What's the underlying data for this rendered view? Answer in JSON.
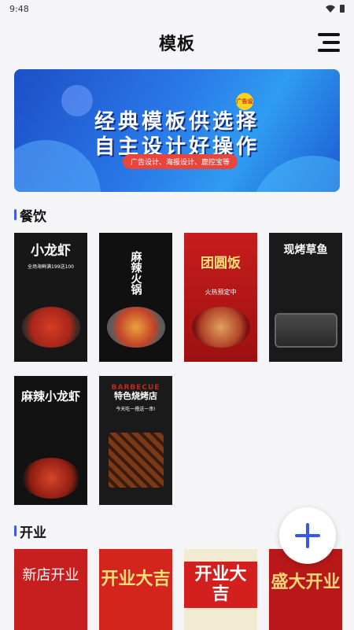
{
  "status": {
    "time": "9:48",
    "wifi_icon": "wifi-icon",
    "battery_icon": "battery-icon"
  },
  "header": {
    "title": "模板",
    "menu_icon": "menu-icon"
  },
  "banner": {
    "line1": "经典模板供选择",
    "line2": "自主设计好操作",
    "sub": "广告设计、海报设计、鹿控宝等",
    "badge": "广告设计"
  },
  "sections": [
    {
      "title": "餐饮",
      "cards": [
        {
          "title": "小龙虾",
          "subtitle": "全场海鲜满199送100"
        },
        {
          "title": "麻辣火锅",
          "subtitle": ""
        },
        {
          "title": "团圆饭",
          "subtitle": "火热预定中"
        },
        {
          "title": "现烤草鱼",
          "subtitle": ""
        },
        {
          "title": "麻辣小龙虾",
          "subtitle": ""
        },
        {
          "pretitle": "BARBECUE",
          "title": "特色烧烤店",
          "subtitle": "今天吃一撸送一串!"
        }
      ]
    },
    {
      "title": "开业",
      "cards": [
        {
          "title": "新店开业"
        },
        {
          "title": "开业大吉"
        },
        {
          "title": "开业大吉"
        },
        {
          "title": "盛大开业"
        }
      ]
    }
  ],
  "fab": {
    "icon": "plus-icon"
  },
  "colors": {
    "accent": "#3657e8",
    "section_bar": "#3d5af1"
  }
}
